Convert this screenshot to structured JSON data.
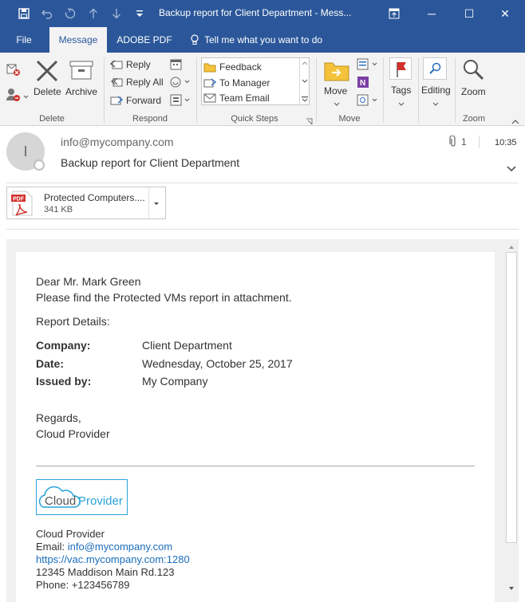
{
  "window": {
    "title": "Backup report for Client Department  -  Mess...",
    "controls": {
      "restore_icon": "window-restore-icon",
      "minimize": "─",
      "maximize": "☐",
      "close": "✕"
    }
  },
  "qat": {
    "save": "save-icon",
    "undo": "undo-icon",
    "redo": "redo-icon",
    "up": "up-arrow-icon",
    "down": "down-arrow-icon",
    "customize": "customize-qat-icon"
  },
  "tabs": [
    {
      "label": "File"
    },
    {
      "label": "Message"
    },
    {
      "label": "ADOBE PDF"
    }
  ],
  "tell_me": "Tell me what you want to do",
  "ribbon": {
    "delete_group": {
      "label": "Delete",
      "delete": "Delete",
      "archive": "Archive"
    },
    "respond_group": {
      "label": "Respond",
      "reply": "Reply",
      "reply_all": "Reply All",
      "forward": "Forward"
    },
    "quick_steps": {
      "label": "Quick Steps",
      "items": [
        "Feedback",
        "To Manager",
        "Team Email"
      ]
    },
    "move_group": {
      "label": "Move",
      "move": "Move"
    },
    "tags": "Tags",
    "editing": "Editing",
    "zoom_group": {
      "label": "Zoom",
      "zoom": "Zoom"
    }
  },
  "message": {
    "avatar_initial": "I",
    "sender": "info@mycompany.com",
    "subject": "Backup report for Client Department",
    "attachment_count": "1",
    "time": "10:35",
    "attachment": {
      "name": "Protected Computers....",
      "size": "341 KB",
      "badge": "PDF"
    }
  },
  "body": {
    "greeting": "Dear Mr. Mark Green",
    "intro": "Please find the Protected VMs report in attachment.",
    "details_heading": "Report Details:",
    "details": [
      {
        "label": "Company:",
        "value": "Client Department"
      },
      {
        "label": "Date:",
        "value": "Wednesday, October 25, 2017"
      },
      {
        "label": "Issued by:",
        "value": "My Company"
      }
    ],
    "regards": "Regards,",
    "signoff": "Cloud Provider",
    "logo": {
      "part1": "Cloud",
      "part2": "Provider"
    },
    "signature": {
      "name": "Cloud Provider",
      "email_label": "Email: ",
      "email": "info@mycompany.com",
      "url": "https://vac.mycompany.com:1280",
      "address": "12345 Maddison Main Rd.123",
      "phone": "Phone: +123456789"
    }
  },
  "colors": {
    "titlebar": "#2b579a",
    "ribbon": "#f3f3f3",
    "link": "#1a6dbb",
    "pdf_red": "#d0312d",
    "logo_blue": "#29a3d8"
  }
}
